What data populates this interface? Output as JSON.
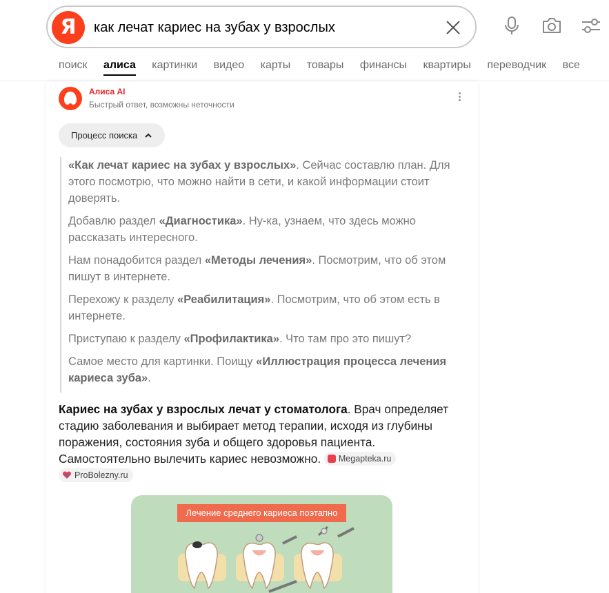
{
  "search": {
    "logo_letter": "Я",
    "query": "как лечат кариес на зубах у взрослых"
  },
  "tabs": [
    "поиск",
    "алиса",
    "картинки",
    "видео",
    "карты",
    "товары",
    "финансы",
    "квартиры",
    "переводчик",
    "все"
  ],
  "card": {
    "name": "Алиса AI",
    "subtitle": "Быстрый ответ, возможны неточности",
    "process_label": "Процесс поиска"
  },
  "process": [
    {
      "bold": "«Как лечат кариес на зубах у взрослых»",
      "text": ". Сейчас составлю план. Для этого посмотрю, что можно найти в сети, и какой информации стоит доверять.",
      "pre": ""
    },
    {
      "pre": "Добавлю раздел ",
      "bold": "«Диагностика»",
      "text": ". Ну-ка, узнаем, что здесь можно рассказать интересного."
    },
    {
      "pre": "Нам понадобится раздел ",
      "bold": "«Методы лечения»",
      "text": ". Посмотрим, что об этом пишут в интернете."
    },
    {
      "pre": "Перехожу к разделу ",
      "bold": "«Реабилитация»",
      "text": ". Посмотрим, что об этом есть в интернете."
    },
    {
      "pre": "Приступаю к разделу ",
      "bold": "«Профилактика»",
      "text": ". Что там про это пишут?"
    },
    {
      "pre": "Самое место для картинки. Поищу ",
      "bold": "«Иллюстрация процесса лечения кариеса зуба»",
      "text": "."
    }
  ],
  "answer": {
    "bold": "Кариес на зубах у взрослых лечат у стоматолога",
    "text": ". Врач определяет стадию заболевания и выбирает метод терапии, исходя из глубины поражения, состояния зуба и общего здоровья пациента. Самостоятельно вылечить кариес невозможно.",
    "sources": [
      "Megapteka.ru",
      "ProBolezny.ru"
    ]
  },
  "illustration": {
    "title": "Лечение среднего кариеса поэтапно"
  },
  "colors": {
    "brand": "#fc3f1d",
    "alice_red": "#e4262a",
    "illus_bg": "#bfdcbc"
  }
}
